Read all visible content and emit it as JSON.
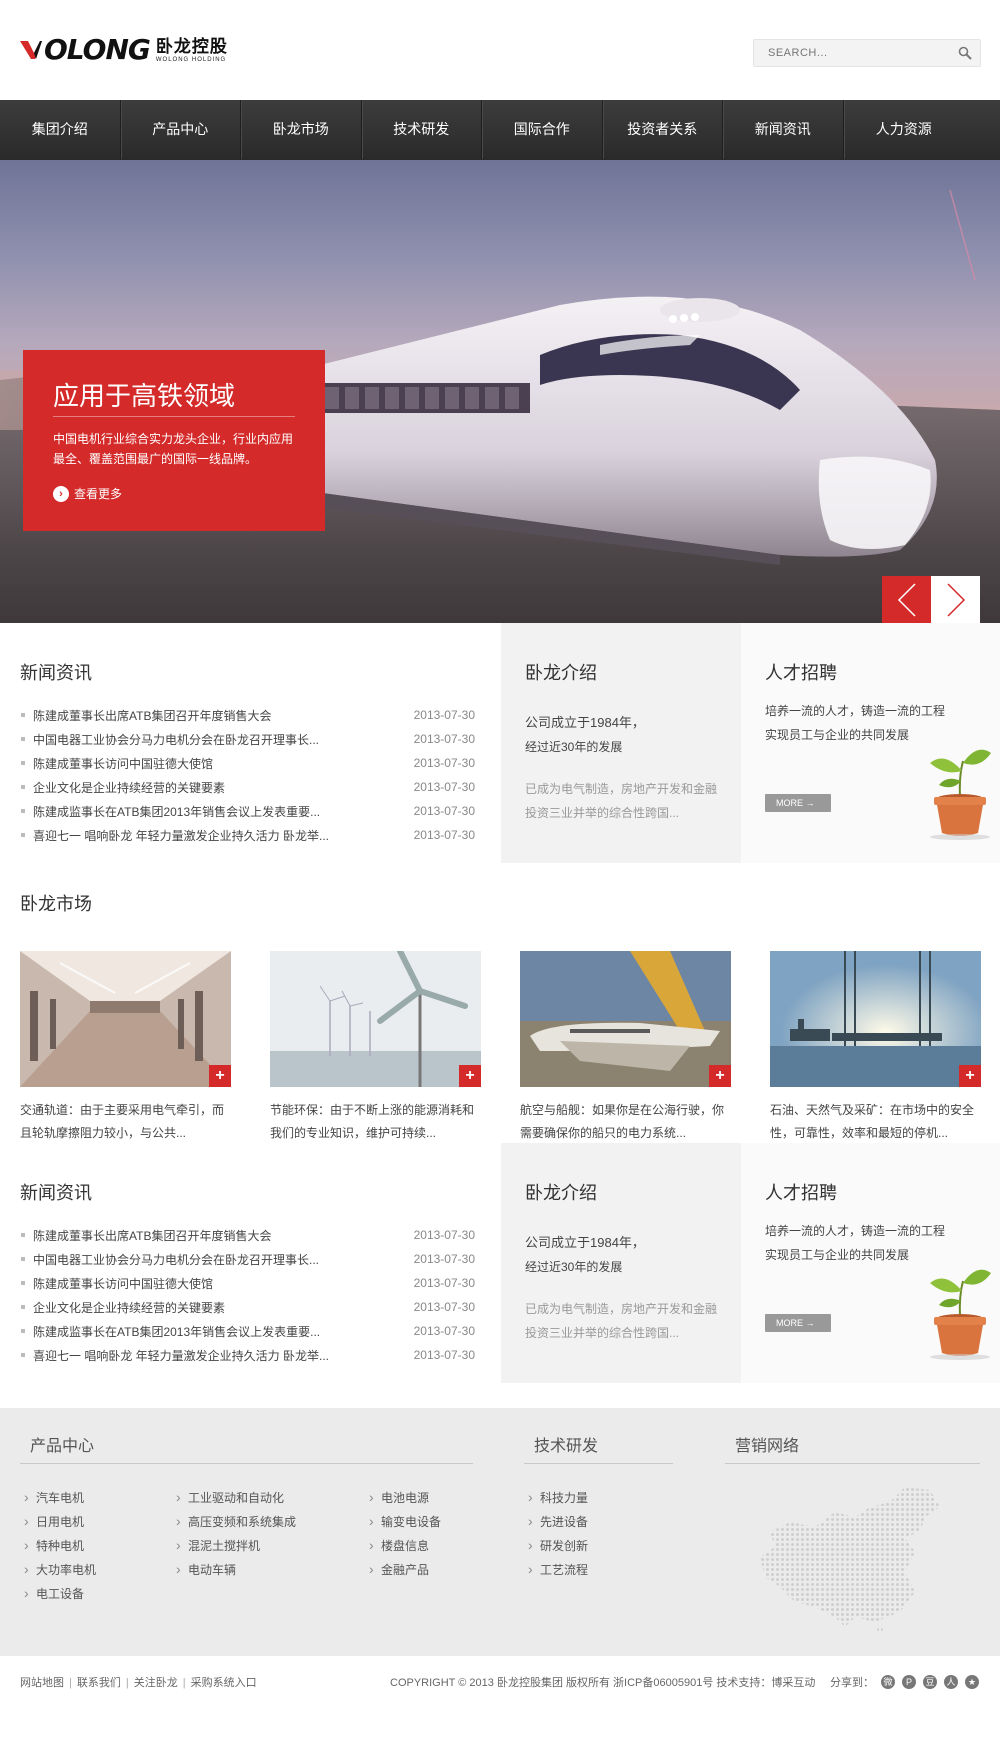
{
  "header": {
    "logo_word": "OLONG",
    "logo_cn": "卧龙控股",
    "logo_en": "WOLONG HOLDING",
    "search_placeholder": "SEARCH..."
  },
  "nav": {
    "items": [
      "集团介绍",
      "产品中心",
      "卧龙市场",
      "技术研发",
      "国际合作",
      "投资者关系",
      "新闻资讯",
      "人力资源"
    ]
  },
  "hero": {
    "title": "应用于高铁领域",
    "desc": "中国电机行业综合实力龙头企业，行业内应用最全、覆盖范围最广的国际一线品牌。",
    "more": "查看更多"
  },
  "news": {
    "title": "新闻资讯",
    "items": [
      {
        "text": "陈建成董事长出席ATB集团召开年度销售大会",
        "date": "2013-07-30"
      },
      {
        "text": "中国电器工业协会分马力电机分会在卧龙召开理事长...",
        "date": "2013-07-30"
      },
      {
        "text": "陈建成董事长访问中国驻德大使馆",
        "date": "2013-07-30"
      },
      {
        "text": "企业文化是企业持续经营的关键要素",
        "date": "2013-07-30"
      },
      {
        "text": "陈建成监事长在ATB集团2013年销售会议上发表重要...",
        "date": "2013-07-30"
      },
      {
        "text": "喜迎七一 唱响卧龙 年轻力量激发企业持久活力 卧龙举...",
        "date": "2013-07-30"
      }
    ]
  },
  "about": {
    "title": "卧龙介绍",
    "line1": "公司成立于1984年，",
    "line2": "经过近30年的发展",
    "line3": "已成为电气制造，房地产开发和金融",
    "line4": "投资三业并举的综合性跨国..."
  },
  "recruit": {
    "title": "人才招聘",
    "line1": "培养一流的人才，铸造一流的工程",
    "line2": "实现员工与企业的共同发展",
    "more": "MORE →"
  },
  "market": {
    "title": "卧龙市场",
    "cards": [
      {
        "cap1": "交通轨道：由于主要采用电气牵引，而",
        "cap2": "且轮轨摩擦阻力较小，与公共..."
      },
      {
        "cap1": "节能环保：由于不断上涨的能源消耗和",
        "cap2": "我们的专业知识，维护可持续..."
      },
      {
        "cap1": "航空与船舰：如果你是在公海行驶，你",
        "cap2": "需要确保你的船只的电力系统..."
      },
      {
        "cap1": "石油、天然气及采矿：在市场中的安全",
        "cap2": "性，可靠性，效率和最短的停机..."
      }
    ]
  },
  "footer": {
    "products_title": "产品中心",
    "col1": [
      "汽车电机",
      "日用电机",
      "特种电机",
      "大功率电机",
      "电工设备"
    ],
    "col2": [
      "工业驱动和自动化",
      "高压变频和系统集成",
      "混泥土搅拌机",
      "电动车辆"
    ],
    "col3": [
      "电池电源",
      "输变电设备",
      "楼盘信息",
      "金融产品"
    ],
    "tech_title": "技术研发",
    "tech": [
      "科技力量",
      "先进设备",
      "研发创新",
      "工艺流程"
    ],
    "network_title": "营销网络"
  },
  "bottom": {
    "links": [
      "网站地图",
      "联系我们",
      "关注卧龙",
      "采购系统入口"
    ],
    "copyright": "COPYRIGHT © 2013 卧龙控股集团 版权所有 浙ICP备06005901号 技术支持：博采互动",
    "share": "分享到："
  },
  "colors": {
    "accent": "#d42a2a",
    "nav_bg": "#333333"
  }
}
